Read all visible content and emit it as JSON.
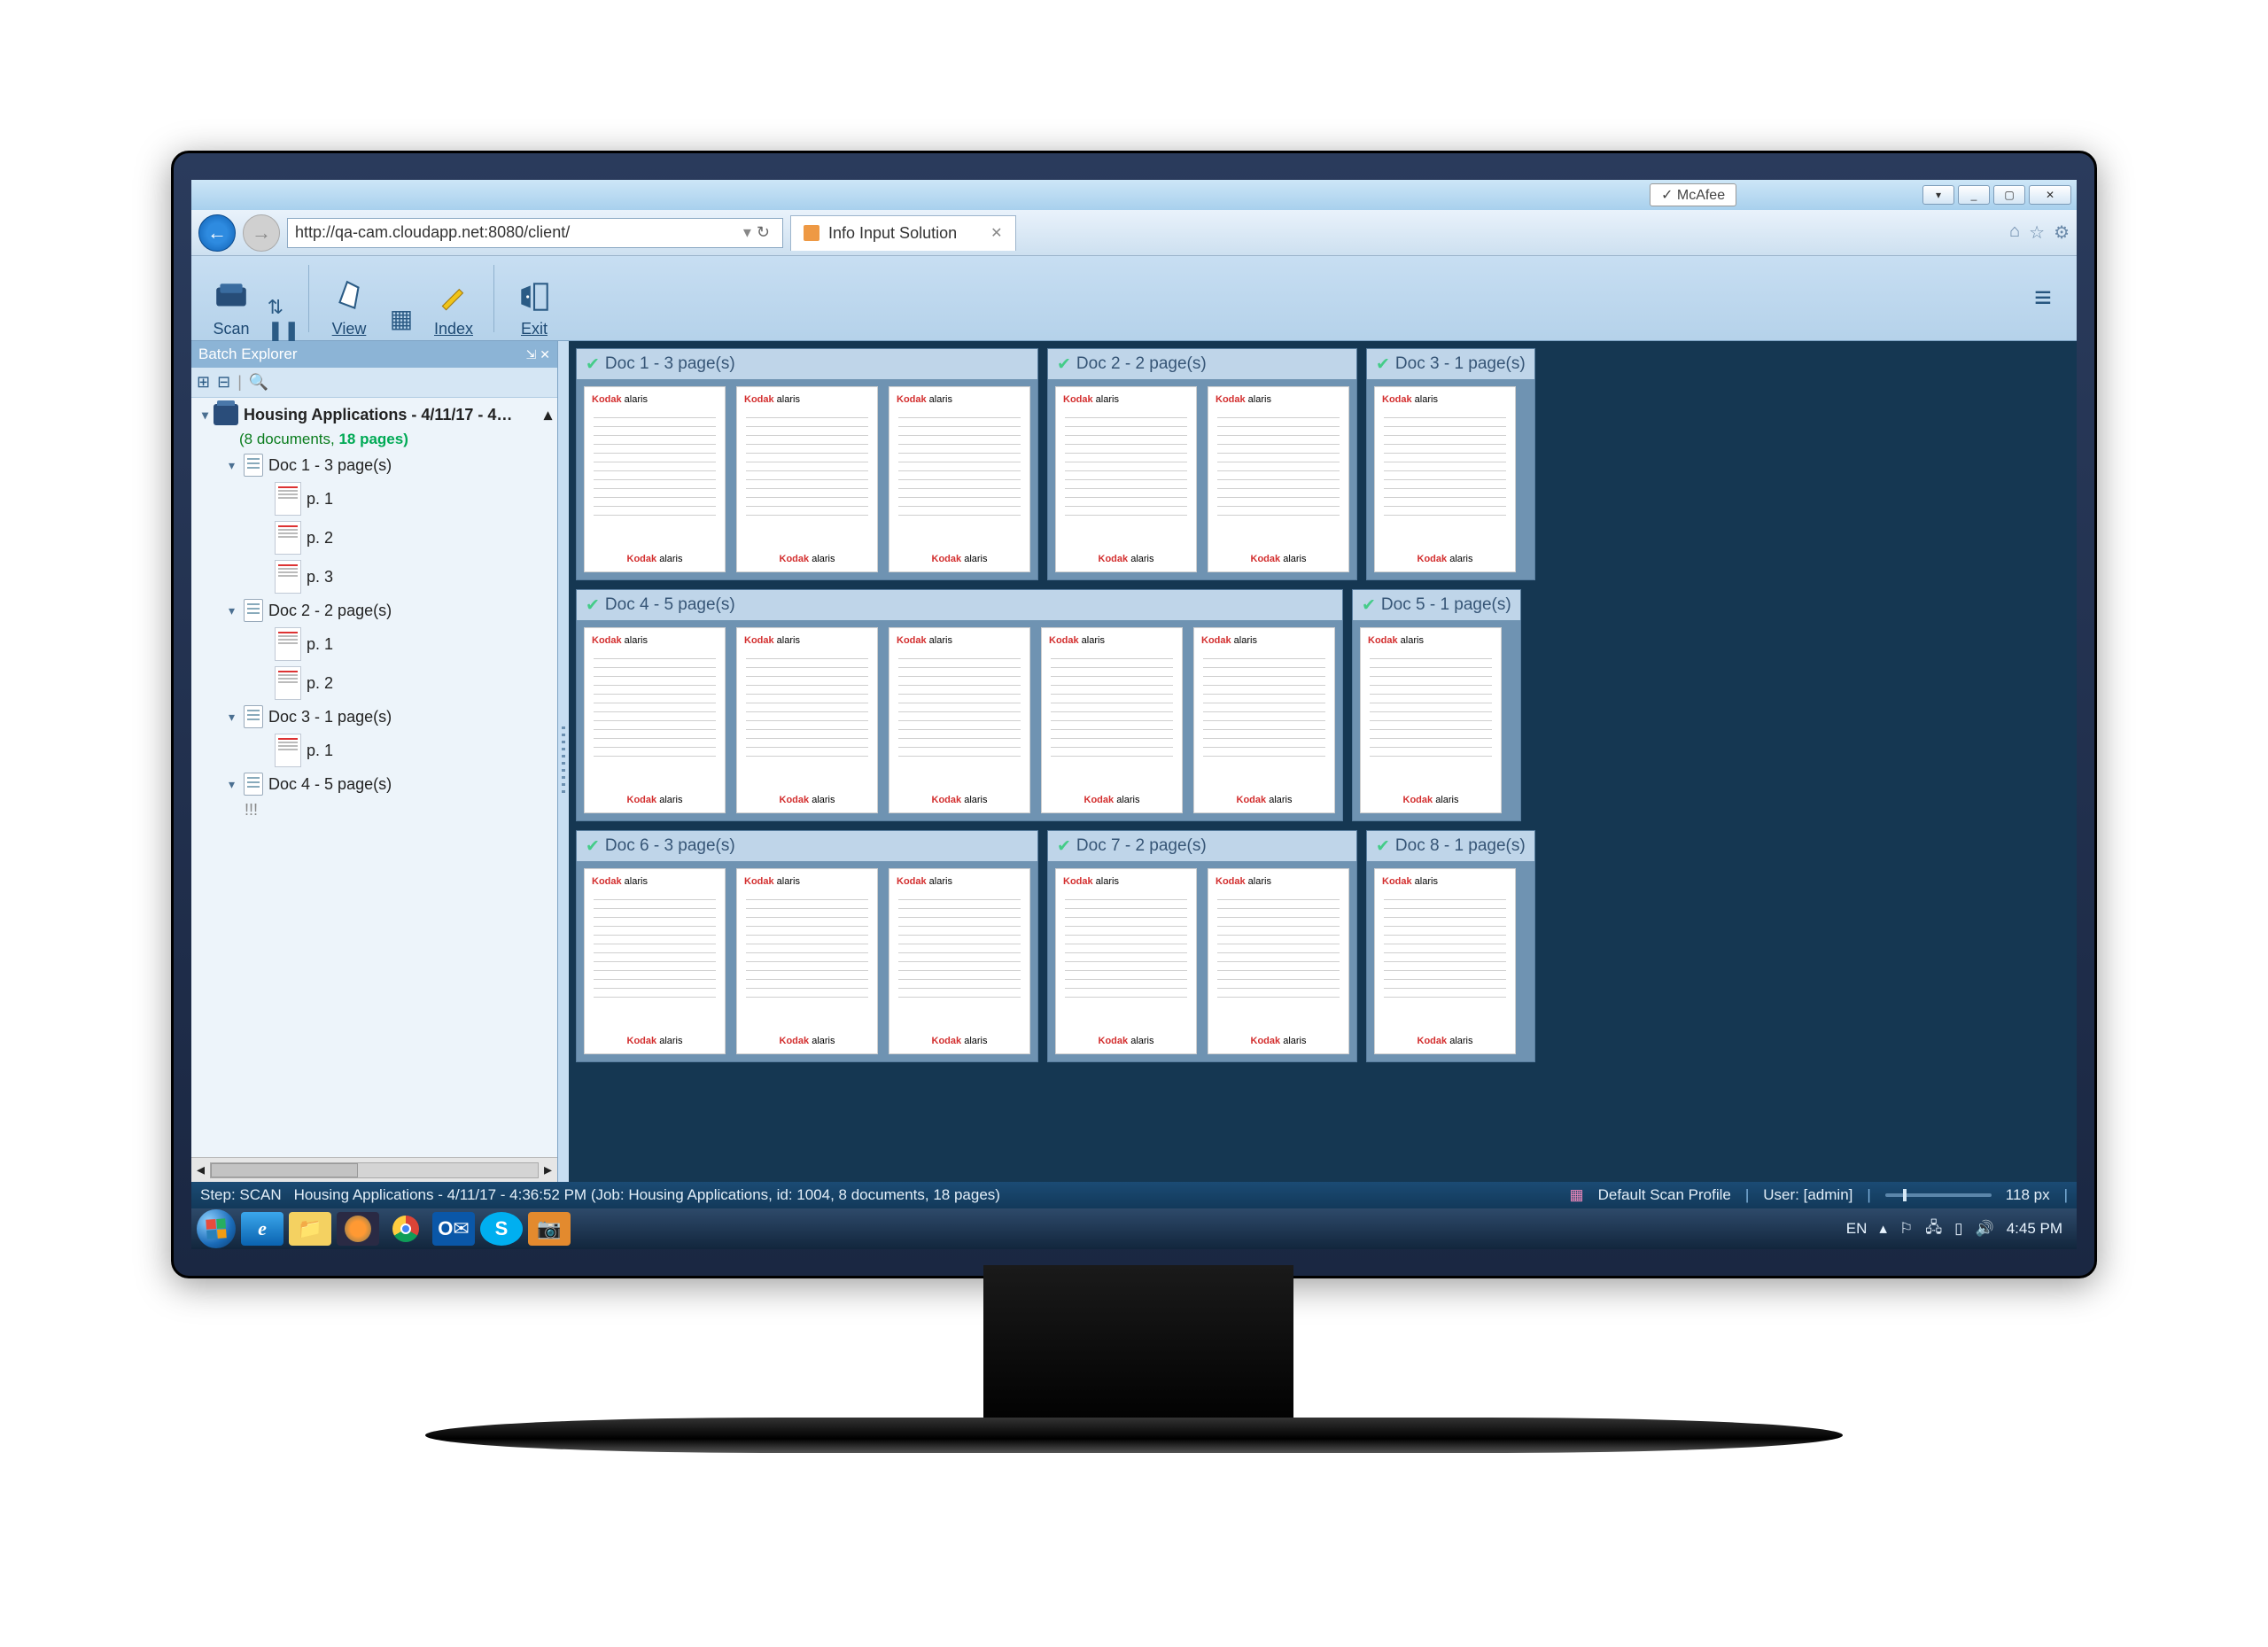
{
  "windows": {
    "mcafee_label": "McAfee",
    "min": "_",
    "max": "▢",
    "close": "✕",
    "dropdown": "▾"
  },
  "browser": {
    "url": "http://qa-cam.cloudapp.net:8080/client/",
    "refresh": "↻",
    "tab_title": "Info Input Solution",
    "home_icon": "⌂",
    "star_icon": "☆",
    "gear_icon": "⚙"
  },
  "toolbar": {
    "scan": "Scan",
    "view": "View",
    "index": "Index",
    "exit": "Exit",
    "menu": "≡"
  },
  "explorer": {
    "title": "Batch Explorer",
    "pin_icons": "⇲ ✕",
    "expand": "⊞",
    "collapse": "⊟",
    "search": "🔍",
    "batch_title": "Housing Applications - 4/11/17 - 4…",
    "batch_counts_a": "(8 documents, ",
    "batch_counts_b": "18 pages)",
    "docs": [
      {
        "title": "Doc 1 - 3 page(s)",
        "pages": [
          "p. 1",
          "p. 2",
          "p. 3"
        ]
      },
      {
        "title": "Doc 2 - 2 page(s)",
        "pages": [
          "p. 1",
          "p. 2"
        ]
      },
      {
        "title": "Doc 3 - 1 page(s)",
        "pages": [
          "p. 1"
        ]
      },
      {
        "title": "Doc 4 - 5 page(s)",
        "pages": []
      }
    ],
    "overflow": "!!!"
  },
  "groups": {
    "r1": [
      {
        "title": "Doc 1 - 3 page(s)",
        "pages": 3
      },
      {
        "title": "Doc 2 - 2 page(s)",
        "pages": 2
      },
      {
        "title": "Doc 3 - 1 page(s)",
        "pages": 1
      }
    ],
    "r2": [
      {
        "title": "Doc 4 - 5 page(s)",
        "pages": 5
      },
      {
        "title": "Doc 5 - 1 page(s)",
        "pages": 1
      }
    ],
    "r3": [
      {
        "title": "Doc 6 - 3 page(s)",
        "pages": 3
      },
      {
        "title": "Doc 7 - 2 page(s)",
        "pages": 2
      },
      {
        "title": "Doc 8 - 1 page(s)",
        "pages": 1
      }
    ]
  },
  "brand_red": "Kodak",
  "brand_rest": " alaris",
  "status": {
    "step": "Step: SCAN",
    "batch": "Housing Applications - 4/11/17 - 4:36:52 PM (Job: Housing Applications, id: 1004, 8 documents, 18 pages)",
    "profile": "Default Scan Profile",
    "user": "User: [admin]",
    "zoom": "118 px",
    "profile_icon": "▦"
  },
  "taskbar": {
    "lang": "EN",
    "tray_caret": "▴",
    "action_center": "⚐",
    "network": "🖧",
    "battery": "▯",
    "sound": "🔊",
    "clock": "4:45 PM"
  },
  "apps": {
    "ie": "e",
    "explorer": "📁",
    "firefox": "🦊",
    "chrome": "◉",
    "outlook": "O",
    "skype": "S",
    "snip": "📷"
  }
}
